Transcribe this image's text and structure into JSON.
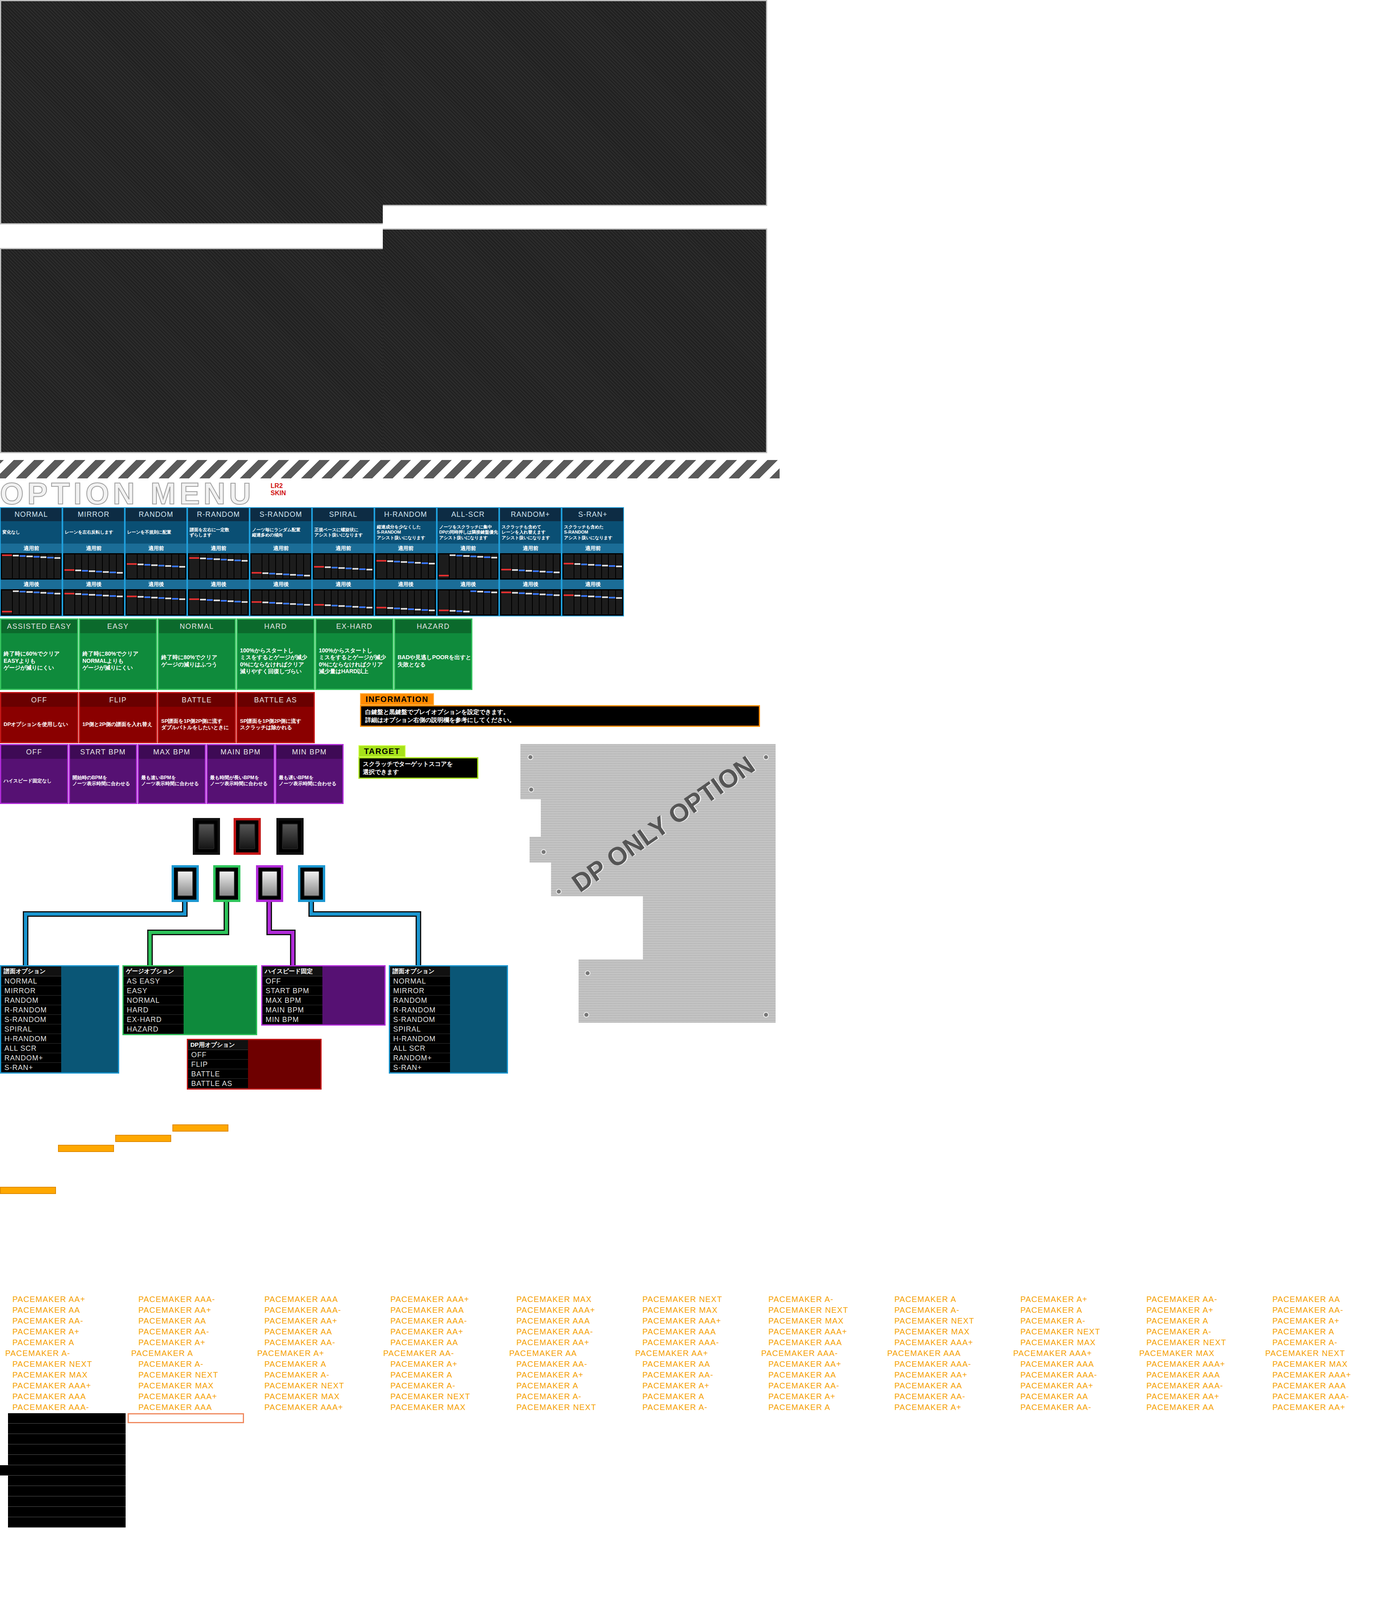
{
  "title": "OPTION MENU",
  "title_badge": [
    "LR2",
    "SKIN"
  ],
  "random_options": [
    {
      "label": "NORMAL",
      "description": [
        "変化なし"
      ]
    },
    {
      "label": "MIRROR",
      "description": [
        "レーンを左右反転します"
      ]
    },
    {
      "label": "RANDOM",
      "description": [
        "レーンを不規則に配置"
      ]
    },
    {
      "label": "R-RANDOM",
      "description": [
        "譜面を左右に一定数",
        "ずらします"
      ]
    },
    {
      "label": "S-RANDOM",
      "description": [
        "ノーツ毎にランダム配置",
        "縦連多めの傾向"
      ]
    },
    {
      "label": "SPIRAL",
      "description": [
        "正規ベースに螺旋状に",
        "アシスト扱いになります"
      ]
    },
    {
      "label": "H-RANDOM",
      "description": [
        "縦連成分を少なくした",
        "S-RANDOM",
        "アシスト扱いになります"
      ]
    },
    {
      "label": "ALL-SCR",
      "description": [
        "ノーツをスクラッチに集中",
        "DPの同時押しは隣接鍵盤優先",
        "アシスト扱いになります"
      ]
    },
    {
      "label": "RANDOM+",
      "description": [
        "スクラッチも含めて",
        "レーンを入れ替えます",
        "アシスト扱いになります"
      ]
    },
    {
      "label": "S-RAN+",
      "description": [
        "スクラッチも含めた",
        "S-RANDOM",
        "アシスト扱いになります"
      ]
    }
  ],
  "preview_labels": {
    "before": "適用前",
    "after": "適用後"
  },
  "gauge_options": [
    {
      "label": "ASSISTED EASY",
      "description": [
        "終了時に60%でクリア",
        "EASYよりも",
        "ゲージが減りにくい"
      ]
    },
    {
      "label": "EASY",
      "description": [
        "終了時に80%でクリア",
        "NORMALよりも",
        "ゲージが減りにくい"
      ]
    },
    {
      "label": "NORMAL",
      "description": [
        "終了時に80%でクリア",
        "ゲージの減りはふつう"
      ]
    },
    {
      "label": "HARD",
      "description": [
        "100%からスタートし",
        "ミスをするとゲージが減少",
        "0%にならなければクリア",
        "減りやすく回復しづらい"
      ]
    },
    {
      "label": "EX-HARD",
      "description": [
        "100%からスタートし",
        "ミスをするとゲージが減少",
        "0%にならなければクリア",
        "減少量はHARD以上"
      ]
    },
    {
      "label": "HAZARD",
      "description": [
        "BADや見逃しPOORを出すと",
        "失敗となる"
      ]
    }
  ],
  "dp_options": [
    {
      "label": "OFF",
      "description": [
        "DPオプションを使用しない"
      ]
    },
    {
      "label": "FLIP",
      "description": [
        "1P側と2P側の譜面を入れ替え"
      ]
    },
    {
      "label": "BATTLE",
      "description": [
        "SP譜面を1P側2P側に流す",
        "ダブルバトルをしたいときに"
      ]
    },
    {
      "label": "BATTLE AS",
      "description": [
        "SP譜面を1P側2P側に流す",
        "スクラッチは除かれる"
      ]
    }
  ],
  "information": {
    "label": "INFORMATION",
    "lines": [
      "白鍵盤と黒鍵盤でプレイオプションを設定できます。",
      "詳細はオプション右側の説明欄を参考にしてください。"
    ]
  },
  "hispeed_options": [
    {
      "label": "OFF",
      "description": [
        "ハイスピード固定なし"
      ]
    },
    {
      "label": "START BPM",
      "description": [
        "開始時のBPMを",
        "ノーツ表示時間に合わせる"
      ]
    },
    {
      "label": "MAX BPM",
      "description": [
        "最も速いBPMを",
        "ノーツ表示時間に合わせる"
      ]
    },
    {
      "label": "MAIN BPM",
      "description": [
        "最も時間が長いBPMを",
        "ノーツ表示時間に合わせる"
      ]
    },
    {
      "label": "MIN BPM",
      "description": [
        "最も遅いBPMを",
        "ノーツ表示時間に合わせる"
      ]
    }
  ],
  "target": {
    "label": "TARGET",
    "lines": [
      "スクラッチでターゲットスコアを",
      "選択できます"
    ]
  },
  "dp_plate": {
    "text": "DP ONLY OPTION"
  },
  "keys": [
    {
      "kind": "black",
      "color": "#111111"
    },
    {
      "kind": "black",
      "color": "#c41616"
    },
    {
      "kind": "black",
      "color": "#111111"
    },
    {
      "kind": "white",
      "color": "#1a96d0"
    },
    {
      "kind": "white",
      "color": "#2dc45a"
    },
    {
      "kind": "white",
      "color": "#b02ad8"
    },
    {
      "kind": "white",
      "color": "#1a96d0"
    }
  ],
  "key_panels": [
    {
      "title": "譜面オプション",
      "color": "#1a96d0",
      "fill": "#0a5676",
      "items": [
        "NORMAL",
        "MIRROR",
        "RANDOM",
        "R-RANDOM",
        "S-RANDOM",
        "SPIRAL",
        "H-RANDOM",
        "ALL SCR",
        "RANDOM+",
        "S-RAN+"
      ]
    },
    {
      "title": "ゲージオプション",
      "color": "#2dc45a",
      "fill": "#0e8a3c",
      "items": [
        "AS EASY",
        "EASY",
        "NORMAL",
        "HARD",
        "EX-HARD",
        "HAZARD"
      ]
    },
    {
      "title": "ハイスピード固定",
      "color": "#b02ad8",
      "fill": "#561173",
      "items": [
        "OFF",
        "START BPM",
        "MAX BPM",
        "MAIN BPM",
        "MIN BPM"
      ]
    },
    {
      "title": "譜面オプション",
      "color": "#1a96d0",
      "fill": "#0a5676",
      "items": [
        "NORMAL",
        "MIRROR",
        "RANDOM",
        "R-RANDOM",
        "S-RANDOM",
        "SPIRAL",
        "H-RANDOM",
        "ALL SCR",
        "RANDOM+",
        "S-RAN+"
      ]
    },
    {
      "title": "DP用オプション",
      "color": "#c41616",
      "fill": "#6e0000",
      "items": [
        "OFF",
        "FLIP",
        "BATTLE",
        "BATTLE AS"
      ]
    }
  ],
  "pacemaker_rows": [
    [
      "PACEMAKER AA+",
      "PACEMAKER AAA-",
      "PACEMAKER AAA",
      "PACEMAKER AAA+",
      "PACEMAKER MAX",
      "PACEMAKER NEXT",
      "PACEMAKER A-",
      "PACEMAKER A",
      "PACEMAKER A+",
      "PACEMAKER AA-",
      "PACEMAKER AA"
    ],
    [
      "PACEMAKER AA",
      "PACEMAKER AA+",
      "PACEMAKER AAA-",
      "PACEMAKER AAA",
      "PACEMAKER AAA+",
      "PACEMAKER MAX",
      "PACEMAKER NEXT",
      "PACEMAKER A-",
      "PACEMAKER A",
      "PACEMAKER A+",
      "PACEMAKER AA-"
    ],
    [
      "PACEMAKER AA-",
      "PACEMAKER AA",
      "PACEMAKER AA+",
      "PACEMAKER AAA-",
      "PACEMAKER AAA",
      "PACEMAKER AAA+",
      "PACEMAKER MAX",
      "PACEMAKER NEXT",
      "PACEMAKER A-",
      "PACEMAKER A",
      "PACEMAKER A+"
    ],
    [
      "PACEMAKER A+",
      "PACEMAKER AA-",
      "PACEMAKER AA",
      "PACEMAKER AA+",
      "PACEMAKER AAA-",
      "PACEMAKER AAA",
      "PACEMAKER AAA+",
      "PACEMAKER MAX",
      "PACEMAKER NEXT",
      "PACEMAKER A-",
      "PACEMAKER A"
    ],
    [
      "PACEMAKER A",
      "PACEMAKER A+",
      "PACEMAKER AA-",
      "PACEMAKER AA",
      "PACEMAKER AA+",
      "PACEMAKER AAA-",
      "PACEMAKER AAA",
      "PACEMAKER AAA+",
      "PACEMAKER MAX",
      "PACEMAKER NEXT",
      "PACEMAKER A-"
    ],
    [
      "PACEMAKER A-",
      "PACEMAKER A",
      "PACEMAKER A+",
      "PACEMAKER AA-",
      "PACEMAKER AA",
      "PACEMAKER AA+",
      "PACEMAKER AAA-",
      "PACEMAKER AAA",
      "PACEMAKER AAA+",
      "PACEMAKER MAX",
      "PACEMAKER NEXT"
    ],
    [
      "PACEMAKER NEXT",
      "PACEMAKER A-",
      "PACEMAKER A",
      "PACEMAKER A+",
      "PACEMAKER AA-",
      "PACEMAKER AA",
      "PACEMAKER AA+",
      "PACEMAKER AAA-",
      "PACEMAKER AAA",
      "PACEMAKER AAA+",
      "PACEMAKER MAX"
    ],
    [
      "PACEMAKER MAX",
      "PACEMAKER NEXT",
      "PACEMAKER A-",
      "PACEMAKER A",
      "PACEMAKER A+",
      "PACEMAKER AA-",
      "PACEMAKER AA",
      "PACEMAKER AA+",
      "PACEMAKER AAA-",
      "PACEMAKER AAA",
      "PACEMAKER AAA+"
    ],
    [
      "PACEMAKER AAA+",
      "PACEMAKER MAX",
      "PACEMAKER NEXT",
      "PACEMAKER A-",
      "PACEMAKER A",
      "PACEMAKER A+",
      "PACEMAKER AA-",
      "PACEMAKER AA",
      "PACEMAKER AA+",
      "PACEMAKER AAA-",
      "PACEMAKER AAA"
    ],
    [
      "PACEMAKER AAA",
      "PACEMAKER AAA+",
      "PACEMAKER MAX",
      "PACEMAKER NEXT",
      "PACEMAKER A-",
      "PACEMAKER A",
      "PACEMAKER A+",
      "PACEMAKER AA-",
      "PACEMAKER AA",
      "PACEMAKER AA+",
      "PACEMAKER AAA-"
    ],
    [
      "PACEMAKER AAA-",
      "PACEMAKER AAA",
      "PACEMAKER AAA+",
      "PACEMAKER MAX",
      "PACEMAKER NEXT",
      "PACEMAKER A-",
      "PACEMAKER A",
      "PACEMAKER A+",
      "PACEMAKER AA-",
      "PACEMAKER AA",
      "PACEMAKER AA+"
    ]
  ]
}
